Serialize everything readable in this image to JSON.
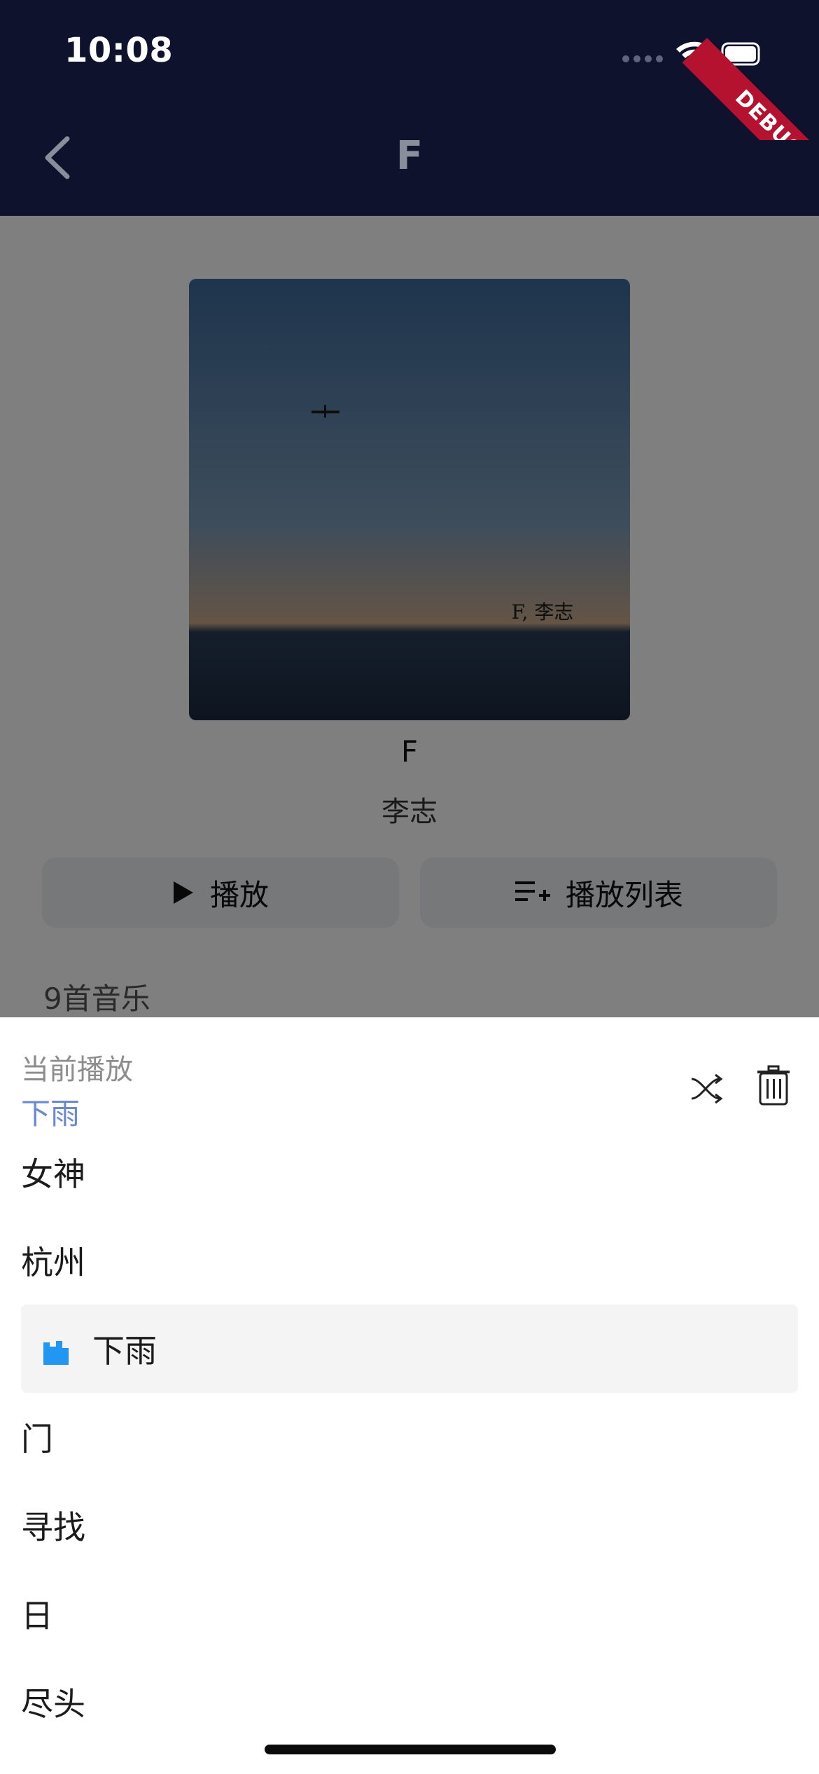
{
  "status_bar": {
    "time": "10:08"
  },
  "debug_banner": "DEBUG",
  "app_bar": {
    "title": "F"
  },
  "album": {
    "title": "F",
    "artist": "李志",
    "cover_text": "F, 李志"
  },
  "actions": {
    "play_label": "播放",
    "playlist_label": "播放列表"
  },
  "track_count_label": "9首音乐",
  "sheet": {
    "now_playing_label": "当前播放",
    "now_playing_song": "下雨",
    "tracks": [
      "女神",
      "杭州",
      "下雨",
      "门",
      "寻找",
      "日",
      "尽头"
    ],
    "active_index": 2
  },
  "colors": {
    "app_bar": "#1d2458",
    "accent": "#2196f3",
    "now_playing": "#6a8ad0",
    "debug": "#b4122e"
  },
  "icons": [
    "chevron-left-icon",
    "wifi-icon",
    "battery-icon",
    "play-icon",
    "playlist-add-icon",
    "shuffle-icon",
    "trash-icon",
    "equalizer-icon"
  ]
}
